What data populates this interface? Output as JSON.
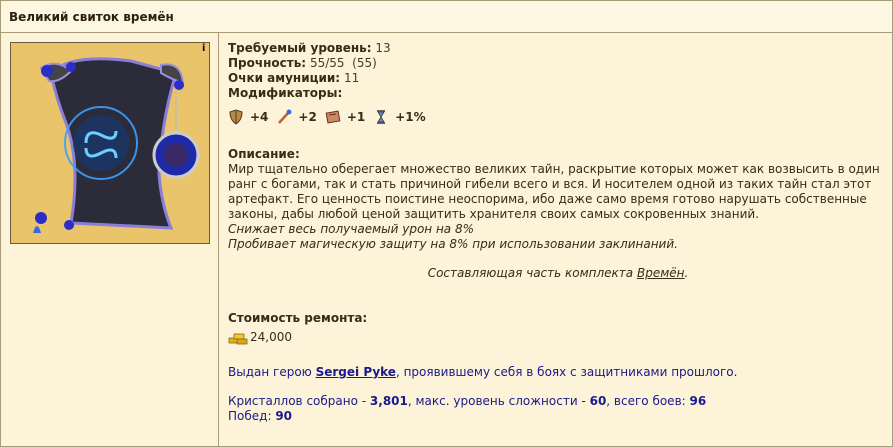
{
  "title": "Великий свиток времён",
  "info_icon": "i",
  "fields": {
    "level_label": "Требуемый уровень:",
    "level_value": "13",
    "durability_label": "Прочность:",
    "durability_value": "55/55  (55)",
    "ammo_label": "Очки амуниции:",
    "ammo_value": "11",
    "modifiers_label": "Модификаторы:"
  },
  "modifiers": [
    {
      "icon": "shield-defense-icon",
      "value": "+4"
    },
    {
      "icon": "wand-spellpower-icon",
      "value": "+2"
    },
    {
      "icon": "book-knowledge-icon",
      "value": "+1"
    },
    {
      "icon": "hourglass-initiative-icon",
      "value": "+1%"
    }
  ],
  "description": {
    "label": "Описание:",
    "text": "Мир тщательно оберегает множество великих тайн, раскрытие которых может как возвысить в один ранг с богами, так и стать причиной гибели всего и вся. И носителем одной из таких тайн стал этот артефакт. Его ценность поистине неоспорима, ибо даже само время готово нарушать собственные законы, дабы любой ценой защитить хранителя своих самых сокровенных знаний.",
    "effect1": "Снижает весь получаемый урон на 8%",
    "effect2": "Пробивает магическую защиту на 8% при использовании заклинаний.",
    "set_prefix": "Составляющая часть комплекта ",
    "set_link": "Времён",
    "set_suffix": "."
  },
  "repair": {
    "label": "Стоимость ремонта:",
    "cost": "24,000",
    "icon": "gold-icon"
  },
  "given": {
    "prefix": "Выдан герою ",
    "hero": "Sergei Pyke",
    "suffix": ", проявившему себя в боях с защитниками прошлого."
  },
  "stats": {
    "crystals_label": "Кристаллов собрано - ",
    "crystals_value": "3,801",
    "difficulty_label": ", макс. уровень сложности - ",
    "difficulty_value": "60",
    "battles_label": ", всего боев: ",
    "battles_value": "96",
    "wins_label": "Побед: ",
    "wins_value": "90"
  },
  "colors": {
    "background": "#fcf3d8",
    "border": "#a89b78",
    "link_blue": "#1a1a8c",
    "art_bg": "#e9c46a"
  }
}
